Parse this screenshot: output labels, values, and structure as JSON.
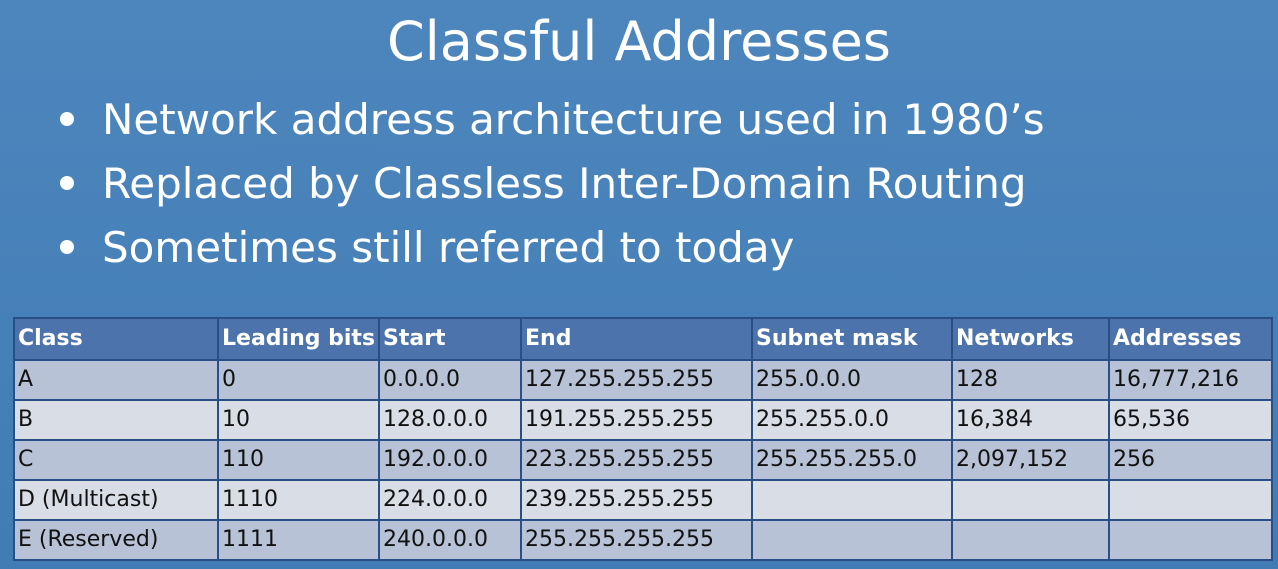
{
  "slide": {
    "title": "Classful Addresses",
    "bullets": [
      "Network address architecture used in 1980’s",
      "Replaced by Classless Inter-Domain Routing",
      "Sometimes still referred to today"
    ]
  },
  "table": {
    "headers": [
      "Class",
      "Leading bits",
      "Start",
      "End",
      "Subnet mask",
      "Networks",
      "Addresses"
    ],
    "rows": [
      [
        "A",
        "0",
        "0.0.0.0",
        "127.255.255.255",
        "255.0.0.0",
        "128",
        "16,777,216"
      ],
      [
        "B",
        "10",
        "128.0.0.0",
        "191.255.255.255",
        "255.255.0.0",
        "16,384",
        "65,536"
      ],
      [
        "C",
        "110",
        "192.0.0.0",
        "223.255.255.255",
        "255.255.255.0",
        "2,097,152",
        "256"
      ],
      [
        "D (Multicast)",
        "1110",
        "224.0.0.0",
        "239.255.255.255",
        "",
        "",
        ""
      ],
      [
        "E (Reserved)",
        "1111",
        "240.0.0.0",
        "255.255.255.255",
        "",
        "",
        ""
      ]
    ]
  },
  "colors": {
    "background": "#4a82b8",
    "header_fill": "#4d73ad",
    "row_odd": "#b8c2d6",
    "row_even": "#d9dde6"
  }
}
